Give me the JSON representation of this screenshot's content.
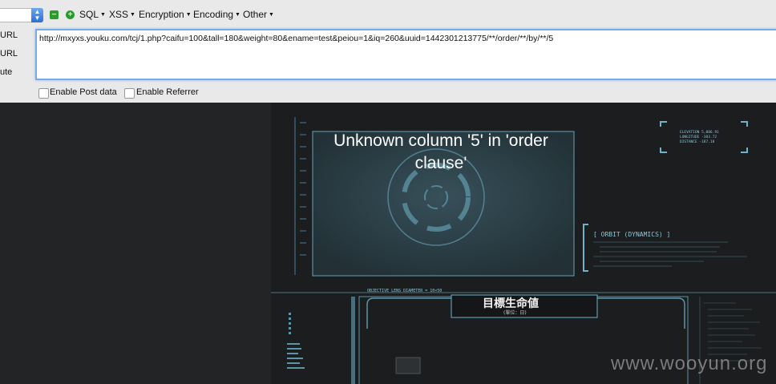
{
  "toolbar": {
    "items": [
      "SQL",
      "XSS",
      "Encryption",
      "Encoding",
      "Other"
    ]
  },
  "side_labels": [
    "URL",
    "URL",
    "ute"
  ],
  "url": {
    "value": "http://mxyxs.youku.com/tcj/1.php?caifu=100&tall=180&weight=80&ename=test&peiou=1&iq=260&uuid=1442301213775/**/order/**/by/**/5"
  },
  "options": {
    "post_label": "Enable Post data",
    "referrer_label": "Enable Referrer"
  },
  "page": {
    "error": "Unknown column '5' in 'order clause'",
    "hud_orbit": "[ ORBIT (DYNAMICS) ]",
    "hud_lens": "OBJECTIVE LENS DIAMETER = 10×50",
    "hud_cjk": "目標生命値",
    "hud_cjk_sub": "(單位：日)"
  },
  "watermark": "www.wooyun.org",
  "colors": {
    "hud": "#5fa8c0",
    "url_border": "#7aaae8",
    "green": "#2e9a2e"
  }
}
